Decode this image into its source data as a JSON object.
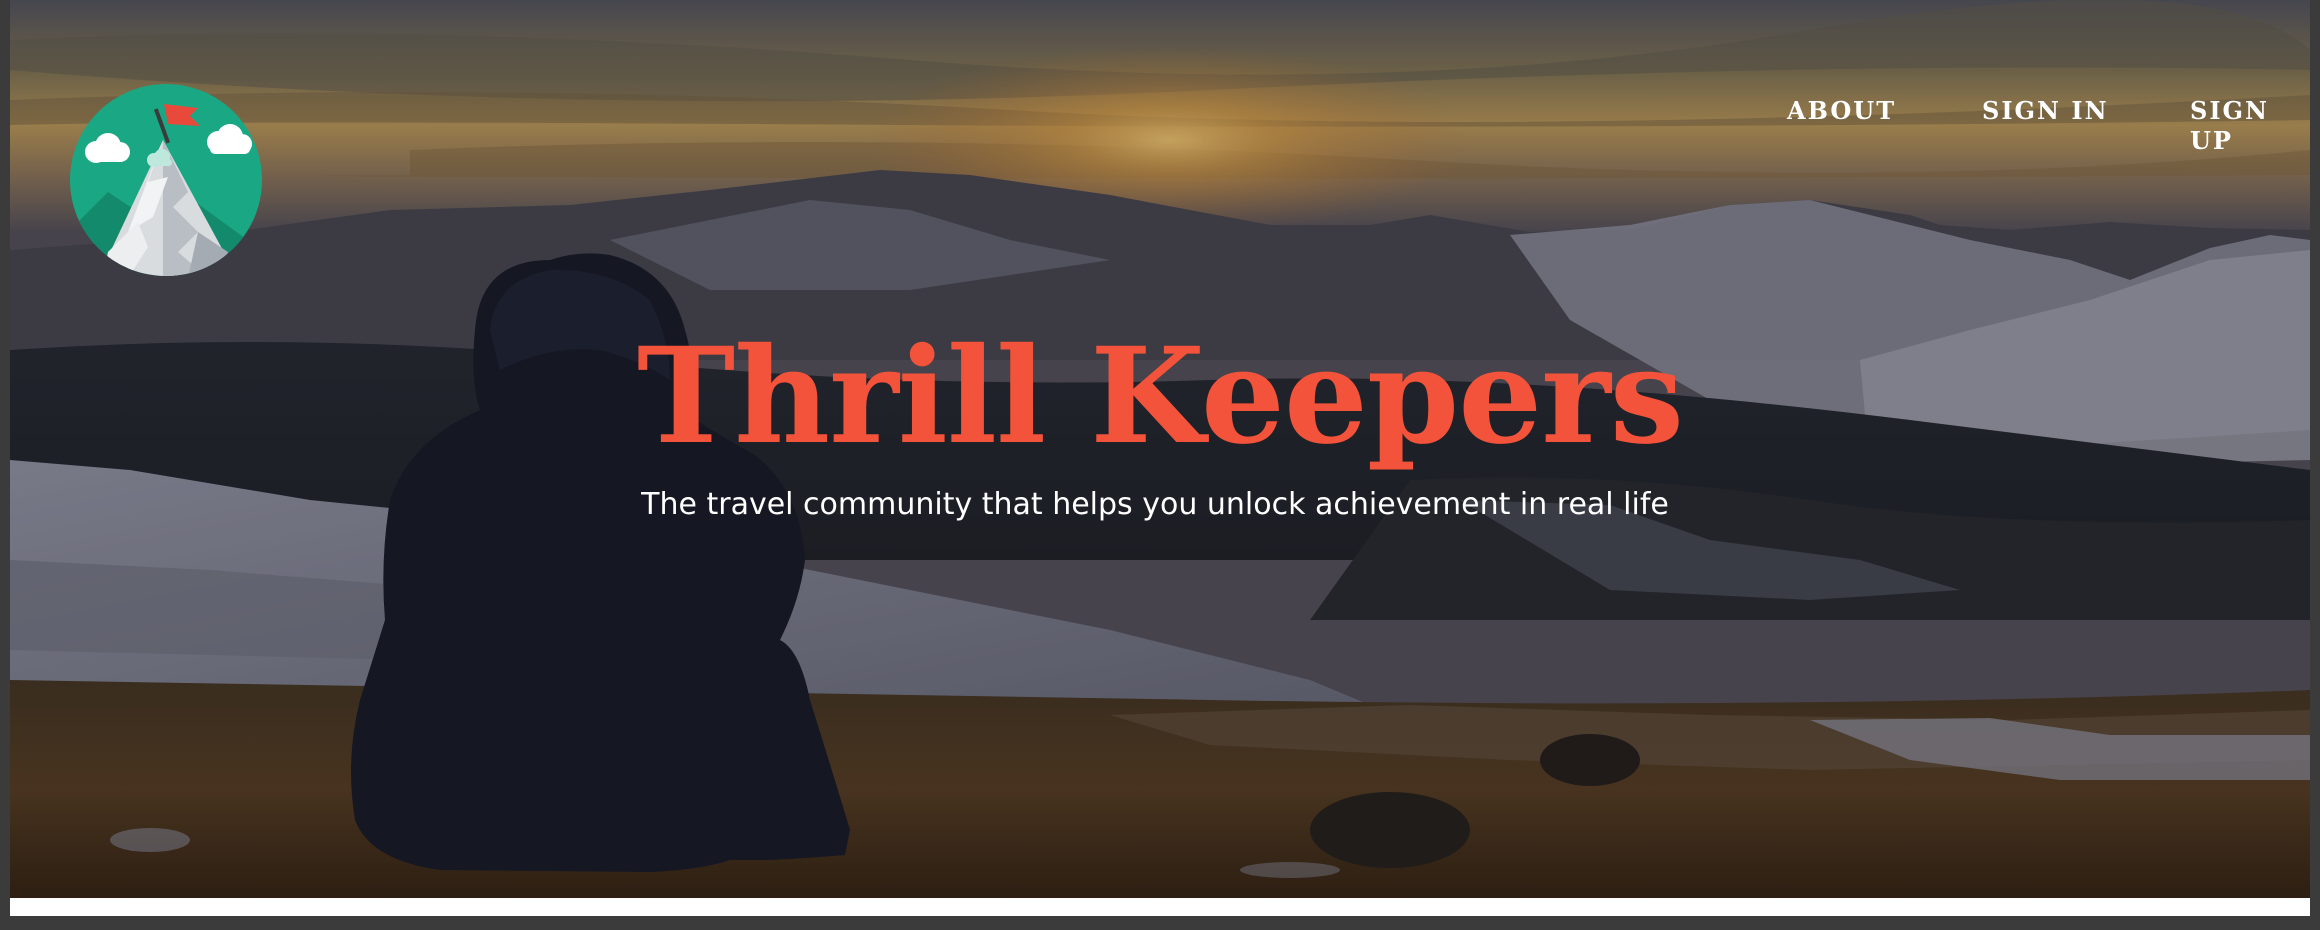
{
  "nav": {
    "about_label": "ABOUT",
    "signin_label": "SIGN IN",
    "signup_label": "SIGN UP"
  },
  "hero": {
    "title": "Thrill Keepers",
    "subtitle": "The travel community that helps you unlock achievement in real life"
  },
  "colors": {
    "title_accent": "#f2533a",
    "logo_circle": "#1aa884",
    "logo_flag": "#e8493a"
  },
  "icons": {
    "logo": "mountain-flag-logo-icon"
  }
}
